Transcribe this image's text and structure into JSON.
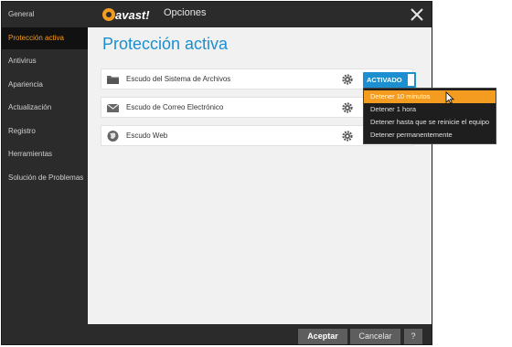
{
  "window": {
    "title": "Opciones",
    "brand": "avast!"
  },
  "sidebar": {
    "items": [
      {
        "label": "General",
        "active": false
      },
      {
        "label": "Protección activa",
        "active": true
      },
      {
        "label": "Antivirus",
        "active": false
      },
      {
        "label": "Apariencia",
        "active": false
      },
      {
        "label": "Actualización",
        "active": false
      },
      {
        "label": "Registro",
        "active": false
      },
      {
        "label": "Herramientas",
        "active": false
      },
      {
        "label": "Solución de Problemas",
        "active": false
      }
    ]
  },
  "main": {
    "title": "Protección activa",
    "shields": [
      {
        "name": "Escudo del Sistema de Archivos",
        "icon": "folder-icon",
        "status": "ACTIVADO"
      },
      {
        "name": "Escudo de Correo Electrónico",
        "icon": "mail-icon"
      },
      {
        "name": "Escudo Web",
        "icon": "globe-icon"
      }
    ]
  },
  "dropdown": {
    "items": [
      "Detener 10 minutos",
      "Detener 1 hora",
      "Detener hasta que se reinicie el equipo",
      "Detener permanentemente"
    ],
    "highlighted_index": 0
  },
  "footer": {
    "accept": "Aceptar",
    "cancel": "Cancelar",
    "help": "?"
  },
  "colors": {
    "accent": "#1b8fcf",
    "highlight": "#f39c1f",
    "sidebar": "#2b2b2b"
  }
}
